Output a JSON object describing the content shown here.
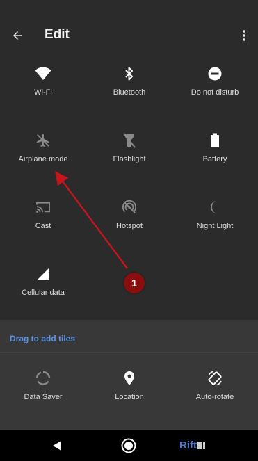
{
  "header": {
    "title": "Edit",
    "back_icon": "arrow-left-icon",
    "menu_icon": "more-vert-icon"
  },
  "active_tiles": [
    {
      "label": "Wi-Fi",
      "icon": "wifi-icon"
    },
    {
      "label": "Bluetooth",
      "icon": "bluetooth-icon"
    },
    {
      "label": "Do not disturb",
      "icon": "do-not-disturb-icon"
    },
    {
      "label": "Airplane mode",
      "icon": "airplane-icon"
    },
    {
      "label": "Flashlight",
      "icon": "flashlight-icon"
    },
    {
      "label": "Battery",
      "icon": "battery-icon"
    },
    {
      "label": "Cast",
      "icon": "cast-icon"
    },
    {
      "label": "Hotspot",
      "icon": "hotspot-icon"
    },
    {
      "label": "Night Light",
      "icon": "night-light-icon"
    },
    {
      "label": "Cellular data",
      "icon": "cellular-icon"
    }
  ],
  "add_section": {
    "title": "Drag to add tiles",
    "tiles": [
      {
        "label": "Data Saver",
        "icon": "data-saver-icon"
      },
      {
        "label": "Location",
        "icon": "location-icon"
      },
      {
        "label": "Auto-rotate",
        "icon": "auto-rotate-icon"
      }
    ]
  },
  "annotation": {
    "number": "1"
  },
  "navbar": {
    "back_icon": "nav-back-icon",
    "home_icon": "nav-home-icon"
  },
  "watermark": "Rift",
  "colors": {
    "background": "#2b2b2b",
    "section_background": "#383838",
    "accent": "#5a92e6",
    "marker": "#8b0e0e",
    "arrow": "#c4161c"
  }
}
